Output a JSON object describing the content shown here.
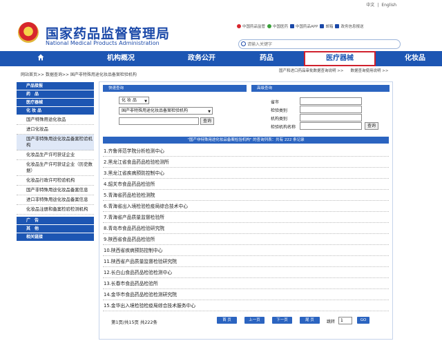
{
  "topbar": {
    "lang_cn": "中文",
    "separator": "|",
    "lang_en": "English"
  },
  "header": {
    "title_cn": "国家药品监督管理局",
    "title_en": "National Medical Products Administration",
    "quicklinks": [
      {
        "label": "中国药品监管",
        "icon": "weibo-icon",
        "color": "#d7262d"
      },
      {
        "label": "中国医药",
        "icon": "weixin-icon",
        "color": "#3aa13a"
      },
      {
        "label": "中国药品APP",
        "icon": "mobile-icon",
        "color": "#1a48a8"
      },
      {
        "label": "邮箱",
        "icon": "mail-icon",
        "color": "#1a48a8"
      },
      {
        "label": "政务信息报送",
        "icon": "report-icon",
        "color": "#1a48a8"
      }
    ],
    "search_placeholder": "请输入关键字"
  },
  "nav": {
    "home_icon": "home-icon",
    "items": [
      "机构概况",
      "政务公开",
      "药品",
      "医疗器械",
      "化妆品"
    ],
    "active": "医疗器械"
  },
  "breadcrumb": "网站首页>> 数据查询>> 国产非特殊用途化妆品备案检验机构",
  "right_links": [
    "国产和进口药品审批数据查询说明 >>",
    "数据查询使用说明 >>"
  ],
  "sidebar": {
    "heads": [
      "产品接报",
      "药　品",
      "医疗器械",
      "化 妆 品"
    ],
    "items": [
      "国产特殊用途化妆品",
      "进口化妆品",
      "国产非特殊用途化妆品备案检验机构",
      "化妆品生产许可获证企业",
      "化妆品生产许可获证企业（历史数据）",
      "化妆品行政许可检验机构",
      "国产非特殊用途化妆品备案信息",
      "进口非特殊用途化妆品备案信息",
      "化妆品注册和备案检验检测机构"
    ],
    "bottom_heads": [
      "广　告",
      "其　他",
      "相关链接"
    ]
  },
  "fast_search": {
    "head": "快速查询",
    "category_value": "化 妆 品",
    "db_value": "国产非特殊用途化妆品备案检验机构",
    "search_btn": "查询"
  },
  "advanced_search": {
    "head": "高级查询",
    "labels": [
      "省市",
      "检验类别",
      "机构类别",
      "检验机构名称"
    ],
    "search_btn": "查询"
  },
  "result_head": "\"国产非特殊用途化妆品备案检验机构\" 的查询列表：共有 222 条记录",
  "results": [
    "1.齐鲁师范学院分析检测中心",
    "2.黑龙江省食品药品检验检测所",
    "3.黑龙江省疾病预防控制中心",
    "4.韶关市食品药品检验所",
    "5.青海省药品检验检测院",
    "6.青海省出入境检验检疫局综合技术中心",
    "7.青海省产品质量监督检验所",
    "8.青岛市食品药品检验研究院",
    "9.陕西省食品药品检验所",
    "10.陕西省疾病预防控制中心",
    "11.陕西省产品质量监督检验研究院",
    "12.长白山食品药品检验检测中心",
    "13.长春市食品药品检验所",
    "14.金华市食品药品检验检测研究院",
    "15.金华出入境检验检疫局综合技术服务中心"
  ],
  "pager": {
    "info": "第1页/共15页 共222条",
    "first": "首 页",
    "prev": "上一页",
    "next": "下一页",
    "last": "尾 页",
    "jump_label": "跳转",
    "jump_value": "1",
    "go": "GO"
  },
  "colors": {
    "brand_blue": "#1d56b3",
    "header_blue": "#2b64c0",
    "highlight_red": "#d0202c"
  }
}
